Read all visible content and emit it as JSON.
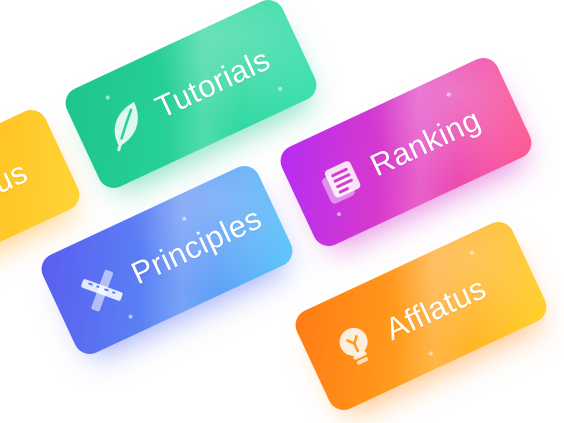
{
  "cards": {
    "partial": {
      "label": "us",
      "icon": "none"
    },
    "tutorials": {
      "label": "Tutorials",
      "icon": "leaf-icon",
      "color_start": "#1fc48a",
      "color_end": "#3ee0b0"
    },
    "ranking": {
      "label": "Ranking",
      "icon": "document-stack-icon",
      "color_start": "#b52cf2",
      "color_end": "#ff5d8f"
    },
    "principles": {
      "label": "Principles",
      "icon": "ruler-pencil-icon",
      "color_start": "#5a5cf0",
      "color_end": "#5cc9fa"
    },
    "afflatus": {
      "label": "Afflatus",
      "icon": "lightbulb-icon",
      "color_start": "#ff7a14",
      "color_end": "#ffd22a"
    }
  }
}
